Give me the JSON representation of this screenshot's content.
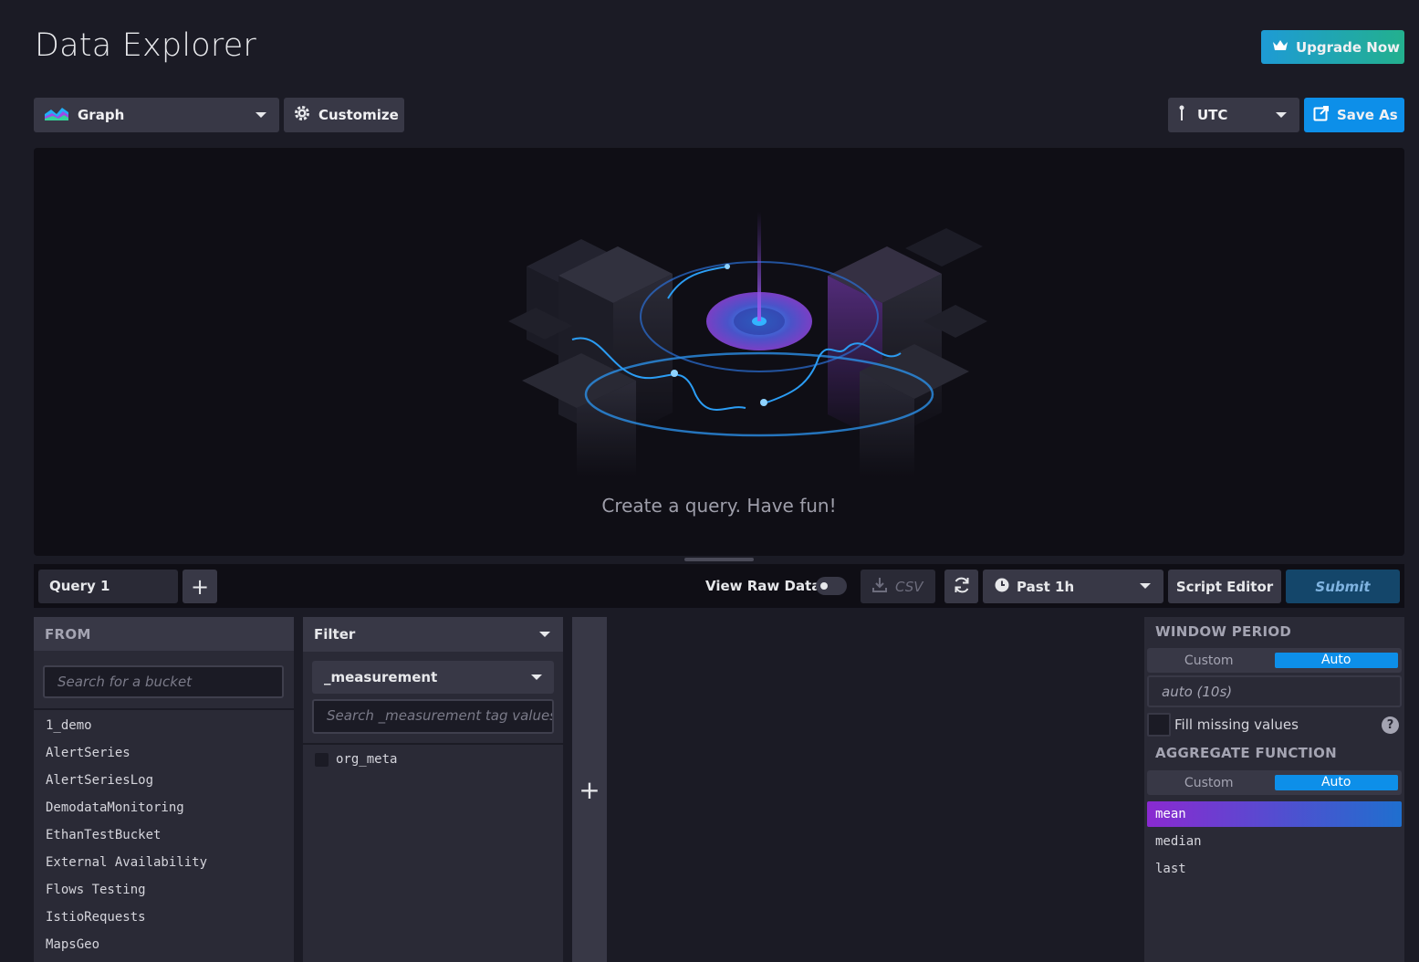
{
  "page": {
    "title": "Data Explorer"
  },
  "header": {
    "upgrade_label": "Upgrade Now",
    "graph_type": "Graph",
    "customize_label": "Customize",
    "timezone": "UTC",
    "save_as_label": "Save As"
  },
  "graph": {
    "empty_message": "Create a query. Have fun!"
  },
  "query_bar": {
    "tabs": [
      {
        "label": "Query 1"
      }
    ],
    "add_query_label": "+",
    "view_raw_label": "View Raw Data",
    "view_raw_enabled": false,
    "csv_label": "CSV",
    "time_range": "Past 1h",
    "script_editor_label": "Script Editor",
    "submit_label": "Submit"
  },
  "from": {
    "title": "FROM",
    "search_placeholder": "Search for a bucket",
    "buckets": [
      "1_demo",
      "AlertSeries",
      "AlertSeriesLog",
      "DemodataMonitoring",
      "EthanTestBucket",
      "External Availability",
      "Flows Testing",
      "IstioRequests",
      "MapsGeo"
    ]
  },
  "filter": {
    "title": "Filter",
    "key": "_measurement",
    "search_placeholder": "Search _measurement tag values",
    "values": [
      {
        "label": "org_meta",
        "checked": false
      }
    ]
  },
  "add_filter_label": "+",
  "aggregate": {
    "window_period_title": "WINDOW PERIOD",
    "window_options": [
      "Custom",
      "Auto"
    ],
    "window_selected": "Auto",
    "window_value": "auto (10s)",
    "fill_missing_label": "Fill missing values",
    "fill_missing_checked": false,
    "help_label": "?",
    "function_title": "AGGREGATE FUNCTION",
    "function_options": [
      "Custom",
      "Auto"
    ],
    "function_mode_selected": "Auto",
    "functions": [
      "mean",
      "median",
      "last"
    ],
    "selected_function": "mean"
  },
  "colors": {
    "accent_blue": "#0d8fe9",
    "upgrade_gradient": [
      "#1e9bd5",
      "#23b08e"
    ],
    "selected_fn_gradient": [
      "#8a2ad0",
      "#1f6fcf"
    ]
  }
}
